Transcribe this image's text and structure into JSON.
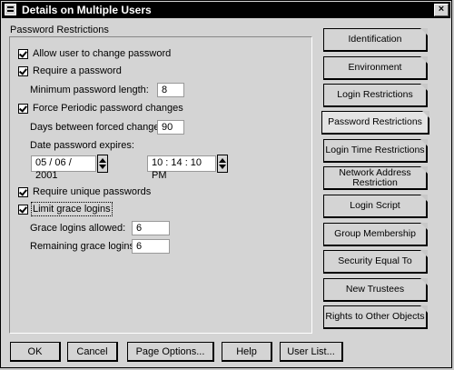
{
  "window": {
    "title": "Details on Multiple Users",
    "close_glyph": "×"
  },
  "group_label": "Password Restrictions",
  "options": {
    "allow_change": {
      "label": "Allow user to change password",
      "checked": true
    },
    "require_password": {
      "label": "Require a password",
      "checked": true
    },
    "min_length_label": "Minimum password length:",
    "min_length_value": "8",
    "force_periodic": {
      "label": "Force Periodic password changes",
      "checked": true
    },
    "days_label": "Days between forced changes:",
    "days_value": "90",
    "expires_label": "Date password expires:",
    "expires_date": "05 / 06 / 2001",
    "expires_time": "10 : 14 : 10 PM",
    "require_unique": {
      "label": "Require unique passwords",
      "checked": true
    },
    "limit_grace": {
      "label": "Limit grace logins",
      "checked": true
    },
    "grace_allowed_label": "Grace logins allowed:",
    "grace_allowed_value": "6",
    "grace_remaining_label": "Remaining grace logins:",
    "grace_remaining_value": "6"
  },
  "tabs": [
    {
      "label": "Identification",
      "active": false
    },
    {
      "label": "Environment",
      "active": false
    },
    {
      "label": "Login Restrictions",
      "active": false
    },
    {
      "label": "Password Restrictions",
      "active": true
    },
    {
      "label": "Login Time Restrictions",
      "active": false
    },
    {
      "label": "Network Address Restriction",
      "active": false
    },
    {
      "label": "Login Script",
      "active": false
    },
    {
      "label": "Group Membership",
      "active": false
    },
    {
      "label": "Security Equal To",
      "active": false
    },
    {
      "label": "New Trustees",
      "active": false
    },
    {
      "label": "Rights to Other Objects",
      "active": false
    }
  ],
  "buttons": {
    "ok": "OK",
    "cancel": "Cancel",
    "page_options": "Page Options...",
    "help": "Help",
    "user_list": "User List..."
  }
}
